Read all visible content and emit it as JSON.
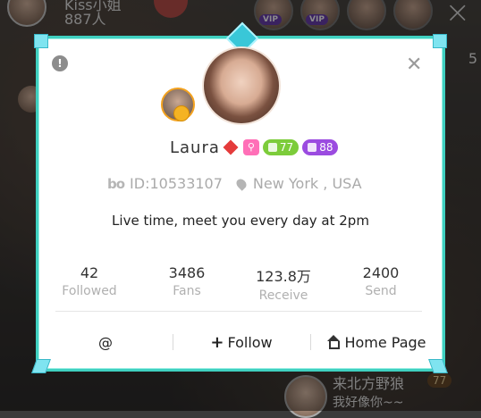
{
  "top": {
    "host_name": "Kiss小姐",
    "host_count": "887人",
    "side_count": "5"
  },
  "viewers": [
    {
      "badge": "VIP"
    },
    {
      "badge": "VIP"
    }
  ],
  "chat": {
    "name": "来北方野狼",
    "level": "77",
    "message": "我好像你~~"
  },
  "profile": {
    "username": "Laura",
    "level_green": "77",
    "level_purple": "88",
    "id_label": "ID:10533107",
    "location": "New York , USA",
    "bio": "Live time, meet you every day at 2pm",
    "stats": [
      {
        "value": "42",
        "label": "Followed"
      },
      {
        "value": "3486",
        "label": "Fans"
      },
      {
        "value": "123.8万",
        "label": "Receive"
      },
      {
        "value": "2400",
        "label": "Send"
      }
    ]
  },
  "actions": {
    "mention": "@",
    "follow": "Follow",
    "home": "Home Page"
  },
  "colors": {
    "frame": "#3fd0c0",
    "green_pill": "#7ccc3a",
    "purple_pill": "#9b4be0",
    "diamond": "#e43b3b"
  }
}
